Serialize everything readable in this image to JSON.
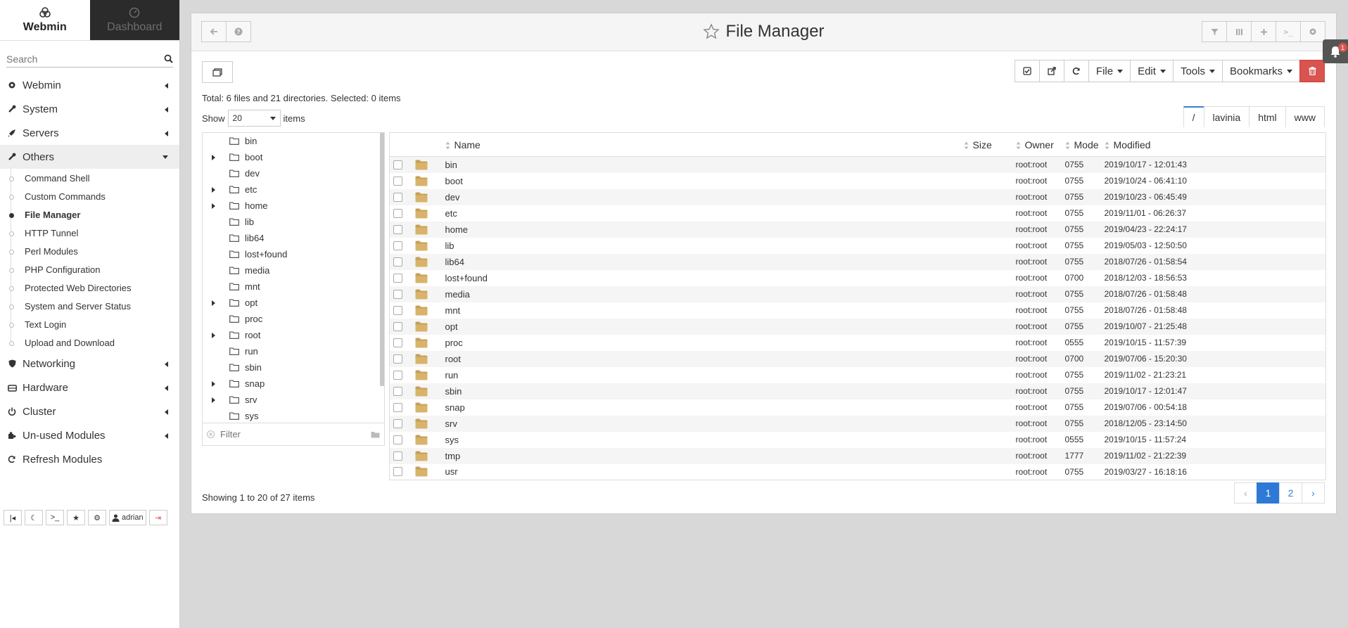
{
  "sidebar": {
    "tab_webmin": "Webmin",
    "tab_dashboard": "Dashboard",
    "search_placeholder": "Search",
    "menu": [
      {
        "label": "Webmin",
        "icon": "gear-icon"
      },
      {
        "label": "System",
        "icon": "wrench-icon"
      },
      {
        "label": "Servers",
        "icon": "rocket-icon"
      },
      {
        "label": "Others",
        "icon": "wrench-icon"
      }
    ],
    "others_items": [
      "Command Shell",
      "Custom Commands",
      "File Manager",
      "HTTP Tunnel",
      "Perl Modules",
      "PHP Configuration",
      "Protected Web Directories",
      "System and Server Status",
      "Text Login",
      "Upload and Download"
    ],
    "menu_bottom": [
      {
        "label": "Networking",
        "icon": "shield-icon"
      },
      {
        "label": "Hardware",
        "icon": "hdd-icon"
      },
      {
        "label": "Cluster",
        "icon": "power-icon"
      },
      {
        "label": "Un-used Modules",
        "icon": "puzzle-icon"
      },
      {
        "label": "Refresh Modules",
        "icon": "refresh-icon"
      }
    ],
    "user": "adrian"
  },
  "header": {
    "title": "File Manager"
  },
  "toolbar": {
    "file": "File",
    "edit": "Edit",
    "tools": "Tools",
    "bookmarks": "Bookmarks"
  },
  "totals": "Total: 6 files and 21 directories. Selected: 0 items",
  "show": {
    "prefix": "Show",
    "value": "20",
    "suffix": "items"
  },
  "breadcrumb": [
    "/",
    "lavinia",
    "html",
    "www"
  ],
  "tree": [
    {
      "name": "bin",
      "expandable": false
    },
    {
      "name": "boot",
      "expandable": true
    },
    {
      "name": "dev",
      "expandable": false
    },
    {
      "name": "etc",
      "expandable": true
    },
    {
      "name": "home",
      "expandable": true
    },
    {
      "name": "lib",
      "expandable": false
    },
    {
      "name": "lib64",
      "expandable": false
    },
    {
      "name": "lost+found",
      "expandable": false
    },
    {
      "name": "media",
      "expandable": false
    },
    {
      "name": "mnt",
      "expandable": false
    },
    {
      "name": "opt",
      "expandable": true
    },
    {
      "name": "proc",
      "expandable": false
    },
    {
      "name": "root",
      "expandable": true
    },
    {
      "name": "run",
      "expandable": false
    },
    {
      "name": "sbin",
      "expandable": false
    },
    {
      "name": "snap",
      "expandable": true
    },
    {
      "name": "srv",
      "expandable": true
    },
    {
      "name": "sys",
      "expandable": false
    }
  ],
  "tree_filter_placeholder": "Filter",
  "columns": {
    "name": "Name",
    "size": "Size",
    "owner": "Owner",
    "mode": "Mode",
    "modified": "Modified"
  },
  "files": [
    {
      "name": "bin",
      "size": "",
      "owner": "root:root",
      "mode": "0755",
      "modified": "2019/10/17 - 12:01:43"
    },
    {
      "name": "boot",
      "size": "",
      "owner": "root:root",
      "mode": "0755",
      "modified": "2019/10/24 - 06:41:10"
    },
    {
      "name": "dev",
      "size": "",
      "owner": "root:root",
      "mode": "0755",
      "modified": "2019/10/23 - 06:45:49"
    },
    {
      "name": "etc",
      "size": "",
      "owner": "root:root",
      "mode": "0755",
      "modified": "2019/11/01 - 06:26:37"
    },
    {
      "name": "home",
      "size": "",
      "owner": "root:root",
      "mode": "0755",
      "modified": "2019/04/23 - 22:24:17"
    },
    {
      "name": "lib",
      "size": "",
      "owner": "root:root",
      "mode": "0755",
      "modified": "2019/05/03 - 12:50:50"
    },
    {
      "name": "lib64",
      "size": "",
      "owner": "root:root",
      "mode": "0755",
      "modified": "2018/07/26 - 01:58:54"
    },
    {
      "name": "lost+found",
      "size": "",
      "owner": "root:root",
      "mode": "0700",
      "modified": "2018/12/03 - 18:56:53"
    },
    {
      "name": "media",
      "size": "",
      "owner": "root:root",
      "mode": "0755",
      "modified": "2018/07/26 - 01:58:48"
    },
    {
      "name": "mnt",
      "size": "",
      "owner": "root:root",
      "mode": "0755",
      "modified": "2018/07/26 - 01:58:48"
    },
    {
      "name": "opt",
      "size": "",
      "owner": "root:root",
      "mode": "0755",
      "modified": "2019/10/07 - 21:25:48"
    },
    {
      "name": "proc",
      "size": "",
      "owner": "root:root",
      "mode": "0555",
      "modified": "2019/10/15 - 11:57:39"
    },
    {
      "name": "root",
      "size": "",
      "owner": "root:root",
      "mode": "0700",
      "modified": "2019/07/06 - 15:20:30"
    },
    {
      "name": "run",
      "size": "",
      "owner": "root:root",
      "mode": "0755",
      "modified": "2019/11/02 - 21:23:21"
    },
    {
      "name": "sbin",
      "size": "",
      "owner": "root:root",
      "mode": "0755",
      "modified": "2019/10/17 - 12:01:47"
    },
    {
      "name": "snap",
      "size": "",
      "owner": "root:root",
      "mode": "0755",
      "modified": "2019/07/06 - 00:54:18"
    },
    {
      "name": "srv",
      "size": "",
      "owner": "root:root",
      "mode": "0755",
      "modified": "2018/12/05 - 23:14:50"
    },
    {
      "name": "sys",
      "size": "",
      "owner": "root:root",
      "mode": "0555",
      "modified": "2019/10/15 - 11:57:24"
    },
    {
      "name": "tmp",
      "size": "",
      "owner": "root:root",
      "mode": "1777",
      "modified": "2019/11/02 - 21:22:39"
    },
    {
      "name": "usr",
      "size": "",
      "owner": "root:root",
      "mode": "0755",
      "modified": "2019/03/27 - 16:18:16"
    }
  ],
  "showing": "Showing 1 to 20 of 27 items",
  "pagination": {
    "prev": "‹",
    "pages": [
      "1",
      "2"
    ],
    "next": "›"
  },
  "notification_count": "1",
  "colors": {
    "accent": "#2d7ad6",
    "danger": "#d9534f",
    "folder": "#c8a055",
    "sidebar_dark": "#2b2b2b"
  }
}
